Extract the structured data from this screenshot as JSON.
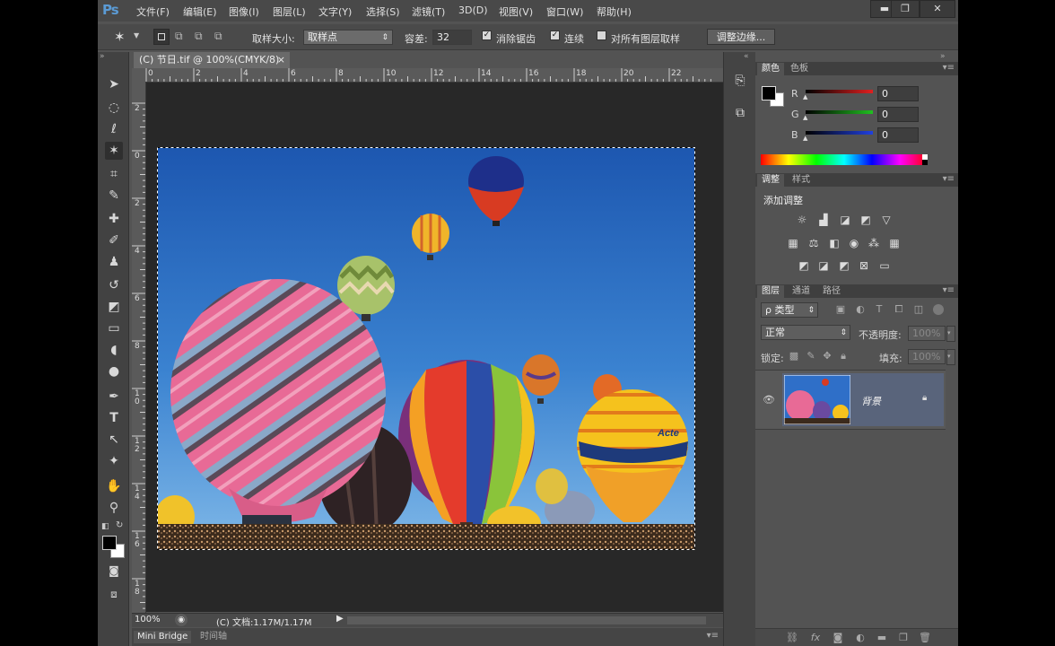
{
  "app": {
    "logo": "Ps"
  },
  "menu": [
    "文件(F)",
    "编辑(E)",
    "图像(I)",
    "图层(L)",
    "文字(Y)",
    "选择(S)",
    "滤镜(T)",
    "3D(D)",
    "视图(V)",
    "窗口(W)",
    "帮助(H)"
  ],
  "window_buttons": {
    "minimize": "▬",
    "restore": "❐",
    "close": "✕"
  },
  "options": {
    "sample_size_label": "取样大小:",
    "sample_size_value": "取样点",
    "tolerance_label": "容差:",
    "tolerance_value": "32",
    "antialias_label": "消除锯齿",
    "contiguous_label": "连续",
    "all_layers_label": "对所有图层取样",
    "refine_edge_label": "调整边缘..."
  },
  "document": {
    "tab_title": "(C) 节日.tif @ 100%(CMYK/8)",
    "tab_close": "×",
    "zoom": "100%",
    "doc_info": "(C) 文档:1.17M/1.17M"
  },
  "rulers": {
    "top": [
      "0",
      "2",
      "4",
      "6",
      "8",
      "10",
      "12",
      "14",
      "16",
      "18",
      "20",
      "22"
    ],
    "left": [
      "2",
      "0",
      "2",
      "4",
      "6",
      "8",
      "10",
      "12",
      "14",
      "16",
      "18"
    ]
  },
  "bottom_tabs": [
    "Mini Bridge",
    "时间轴"
  ],
  "color_panel": {
    "tabs": [
      "颜色",
      "色板"
    ],
    "channels": [
      {
        "label": "R",
        "value": "0",
        "color": "#e02020"
      },
      {
        "label": "G",
        "value": "0",
        "color": "#20c020"
      },
      {
        "label": "B",
        "value": "0",
        "color": "#2040e0"
      }
    ]
  },
  "adjust_panel": {
    "tabs": [
      "调整",
      "样式"
    ],
    "title": "添加调整"
  },
  "layers_panel": {
    "tabs": [
      "图层",
      "通道",
      "路径"
    ],
    "filter_label": "ρ 类型",
    "blend_mode": "正常",
    "opacity_label": "不透明度:",
    "opacity_value": "100%",
    "lock_label": "锁定:",
    "fill_label": "填充:",
    "fill_value": "100%",
    "layers": [
      {
        "name": "背景",
        "visible": true,
        "locked": true
      }
    ]
  },
  "colors": {
    "accent": "#5b9bd5",
    "selected_layer": "#59647b"
  }
}
